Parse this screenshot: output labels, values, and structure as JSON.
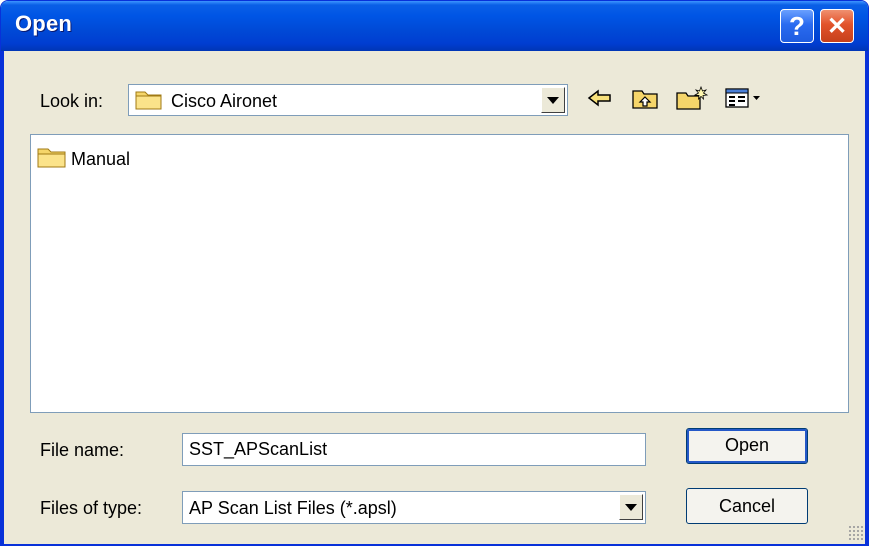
{
  "window": {
    "title": "Open",
    "help_button": "?",
    "close_button": "✕"
  },
  "lookin": {
    "label": "Look in:",
    "value": "Cisco Aironet"
  },
  "toolbar": {
    "icons": [
      "back-icon",
      "up-folder-icon",
      "new-folder-icon",
      "view-menu-icon"
    ]
  },
  "files": [
    {
      "name": "Manual",
      "type": "folder"
    }
  ],
  "filename": {
    "label": "File name:",
    "value": "SST_APScanList"
  },
  "filetype": {
    "label": "Files of type:",
    "value": "AP Scan List Files (*.apsl)"
  },
  "buttons": {
    "open": "Open",
    "cancel": "Cancel"
  },
  "colors": {
    "titlebar": "#0055e5",
    "dialog_bg": "#ece9d8",
    "folder": "#f5d56a"
  }
}
